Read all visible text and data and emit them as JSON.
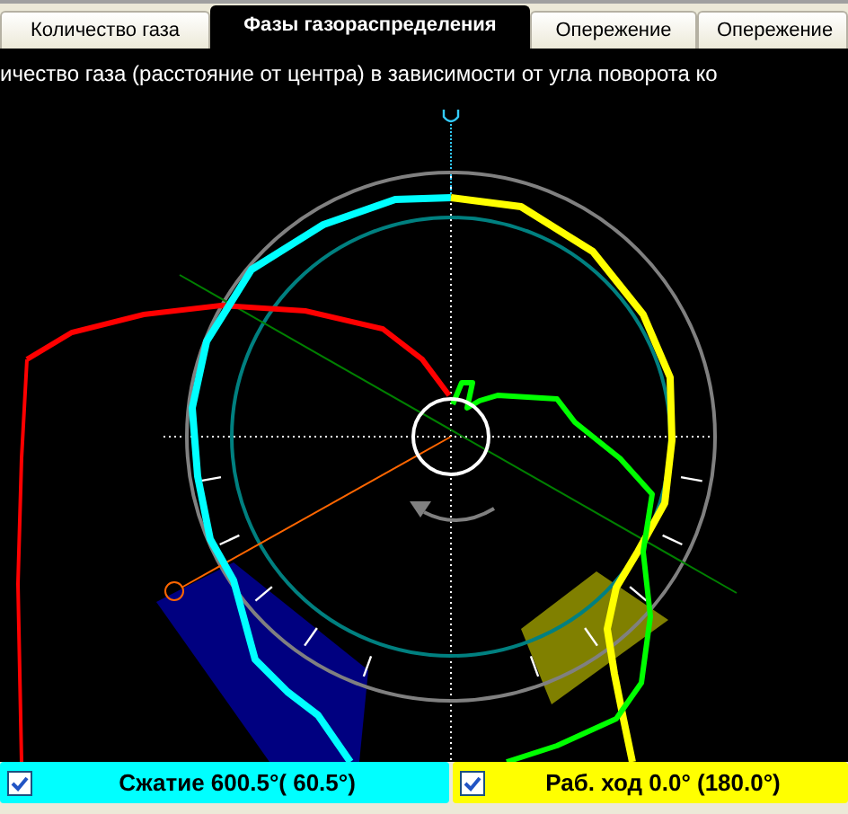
{
  "tabs": [
    {
      "label": "Количество газа",
      "selected": false
    },
    {
      "label": "Фазы газораспределения",
      "selected": true
    },
    {
      "label": "Опережение",
      "selected": false
    },
    {
      "label": "Опережение",
      "selected": false
    }
  ],
  "caption": "ичество газа (расстояние от центра) в зависимости от угла поворота ко",
  "phases": [
    {
      "label": "Сжатие 600.5°( 60.5°)",
      "checked": true,
      "color": "#00ffff"
    },
    {
      "label": "Раб. ход 0.0° (180.0°)",
      "checked": true,
      "color": "#ffff00"
    }
  ]
}
